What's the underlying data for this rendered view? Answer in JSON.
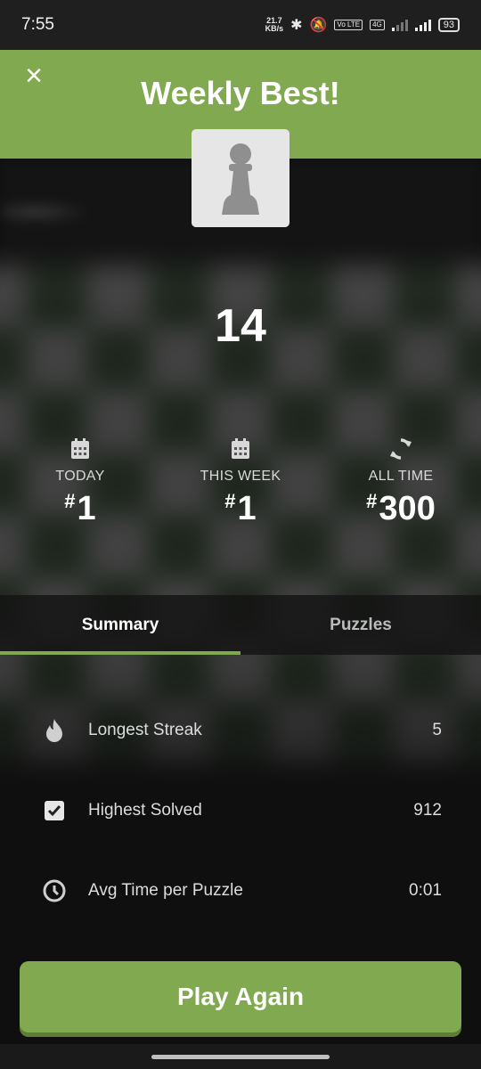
{
  "status_bar": {
    "time": "7:55",
    "net_speed_top": "21.7",
    "net_speed_bottom": "KB/s",
    "volte": "Vo LTE",
    "network": "4G",
    "battery": "93"
  },
  "header": {
    "title": "Weekly Best!",
    "bg_color": "#81a94f"
  },
  "score": "14",
  "ranks": [
    {
      "label": "TODAY",
      "hash": "#",
      "value": "1",
      "icon": "calendar-icon"
    },
    {
      "label": "THIS WEEK",
      "hash": "#",
      "value": "1",
      "icon": "calendar-icon"
    },
    {
      "label": "ALL TIME",
      "hash": "#",
      "value": "300",
      "icon": "refresh-icon"
    }
  ],
  "tabs": [
    {
      "label": "Summary",
      "active": true
    },
    {
      "label": "Puzzles",
      "active": false
    }
  ],
  "stats": [
    {
      "label": "Longest Streak",
      "value": "5",
      "icon": "flame-icon"
    },
    {
      "label": "Highest Solved",
      "value": "912",
      "icon": "checkbox-icon"
    },
    {
      "label": "Avg Time per Puzzle",
      "value": "0:01",
      "icon": "clock-icon"
    }
  ],
  "play_button": {
    "label": "Play Again"
  },
  "colors": {
    "accent": "#81a94f",
    "background": "#0f0f0f"
  }
}
